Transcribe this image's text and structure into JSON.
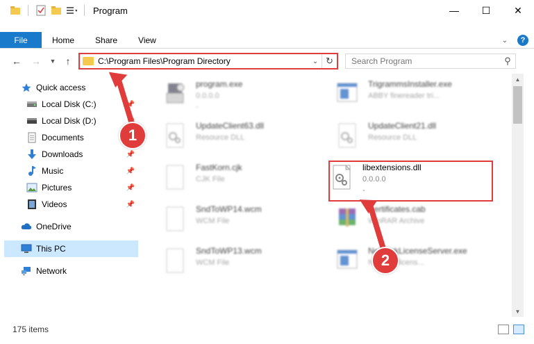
{
  "window": {
    "title": "Program",
    "minimize": "—",
    "maximize": "☐",
    "close": "✕"
  },
  "ribbon": {
    "file": "File",
    "tabs": [
      "Home",
      "Share",
      "View"
    ],
    "help": "?"
  },
  "address": {
    "path": "C:\\Program Files\\Program Directory",
    "search_placeholder": "Search Program"
  },
  "sidebar": {
    "items": [
      {
        "label": "Quick access",
        "icon": "star-icon"
      },
      {
        "label": "Local Disk (C:)",
        "icon": "drive-icon"
      },
      {
        "label": "Local Disk (D:)",
        "icon": "drive-icon"
      },
      {
        "label": "Documents",
        "icon": "documents-icon"
      },
      {
        "label": "Downloads",
        "icon": "download-icon"
      },
      {
        "label": "Music",
        "icon": "music-icon"
      },
      {
        "label": "Pictures",
        "icon": "pictures-icon"
      },
      {
        "label": "Videos",
        "icon": "videos-icon"
      },
      {
        "label": "OneDrive",
        "icon": "cloud-icon"
      },
      {
        "label": "This PC",
        "icon": "computer-icon"
      },
      {
        "label": "Network",
        "icon": "network-icon"
      }
    ]
  },
  "files": [
    {
      "name": "program.exe",
      "sub": "0.0.0.0",
      "sub2": "-",
      "icon": "exe-icon"
    },
    {
      "name": "TrigrammsInstaller.exe",
      "sub": "ABBY finereader tri...",
      "sub2": "",
      "icon": "installer-icon"
    },
    {
      "name": "UpdateClient63.dll",
      "sub": "Resource DLL",
      "sub2": "",
      "icon": "dll-icon"
    },
    {
      "name": "UpdateClient21.dll",
      "sub": "Resource DLL",
      "sub2": "",
      "icon": "dll-icon"
    },
    {
      "name": "FastKorn.cjk",
      "sub": "CJK File",
      "sub2": "",
      "icon": "file-icon"
    },
    {
      "name": "libextensions.dll",
      "sub": "0.0.0.0",
      "sub2": "-",
      "icon": "dll-icon"
    },
    {
      "name": "SndToWP14.wcm",
      "sub": "WCM File",
      "sub2": "",
      "icon": "file-icon"
    },
    {
      "name": "Certificates.cab",
      "sub": "WinRAR Archive",
      "sub2": "",
      "icon": "archive-icon"
    },
    {
      "name": "SndToWP13.wcm",
      "sub": "WCM File",
      "sub2": "",
      "icon": "file-icon"
    },
    {
      "name": "NetworkLicenseServer.exe",
      "sub": "Network licens...",
      "sub2": "",
      "icon": "installer-icon"
    }
  ],
  "status": {
    "count": "175 items"
  },
  "callouts": {
    "one": "1",
    "two": "2"
  },
  "colors": {
    "accent": "#1979ca",
    "highlight": "#e03c3c",
    "selected": "#cce8ff"
  }
}
